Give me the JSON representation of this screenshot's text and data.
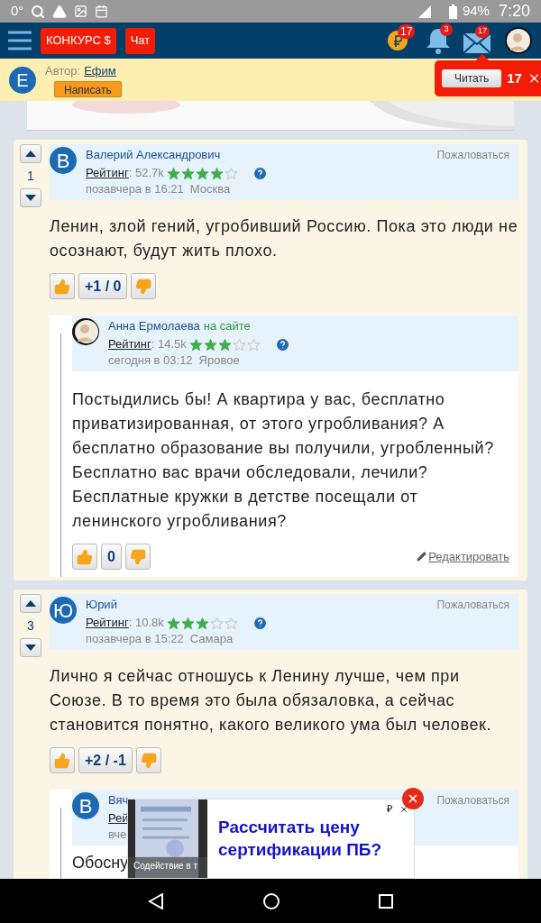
{
  "status_bar": {
    "temperature": "0°",
    "battery": "94%",
    "time": "7:20"
  },
  "nav": {
    "buttons": [
      "КОНКУРС $",
      "Чат"
    ],
    "coin_badge": "17",
    "bell_badge": "3",
    "mail_badge": "17"
  },
  "author_bar": {
    "avatar_letter": "Е",
    "label": "Автор:",
    "author": "Ефим",
    "write_button": "Написать"
  },
  "message_popup": {
    "read_button": "Читать",
    "count": "17"
  },
  "comments": [
    {
      "vote_count": "1",
      "avatar": {
        "kind": "letter",
        "letter": "В"
      },
      "name": "Валерий Александрович",
      "report": "Пожаловаться",
      "rating_label": "Рейтинг",
      "rating_value": ": 52.7k",
      "stars": 4,
      "date": "позавчера в 16:21",
      "city": "Москва",
      "text": "Ленин, злой гений, угробивший Россию. Пока это люди не осознают, будут жить плохо.",
      "votes": "+1 / 0",
      "reply": {
        "name": "Анна Ермолаева",
        "online": "на сайте",
        "rating_label": "Рейтинг",
        "rating_value": ": 14.5k",
        "stars": 3,
        "date": "сегодня в 03:12",
        "city": "Яровое",
        "text": "Постыдились бы! А квартира у вас, бесплатно приватизированная, от этого угробливания? А бесплатно образование вы получили, угробленный? Бесплатно вас врачи обследовали, лечили? Бесплатные кружки в детстве посещали от ленинского угробливания?",
        "votes": "0",
        "edit_link": "Редактировать"
      }
    },
    {
      "vote_count": "3",
      "avatar": {
        "kind": "letter",
        "letter": "Ю"
      },
      "name": "Юрий",
      "report": "Пожаловаться",
      "rating_label": "Рейтинг",
      "rating_value": ": 10.8k",
      "stars": 3,
      "date": "позавчера в 15:22",
      "city": "Самара",
      "text": "Лично я сейчас отношусь к Ленину лучше, чем при Союзе. В то время это была обязаловка, а сейчас становится понятно, какого великого ума был человек.",
      "votes": "+2 / -1",
      "reply": {
        "avatar": {
          "kind": "letter",
          "letter": "В"
        },
        "name": "Вяч",
        "report": "Пожаловаться",
        "rating_label": "Рей",
        "date": "вче",
        "text": "Обосну",
        "ad": {
          "image_caption": "Содействие в т",
          "currency": "₽",
          "title": "Рассчитать цену сертификации ПБ?"
        }
      }
    }
  ]
}
